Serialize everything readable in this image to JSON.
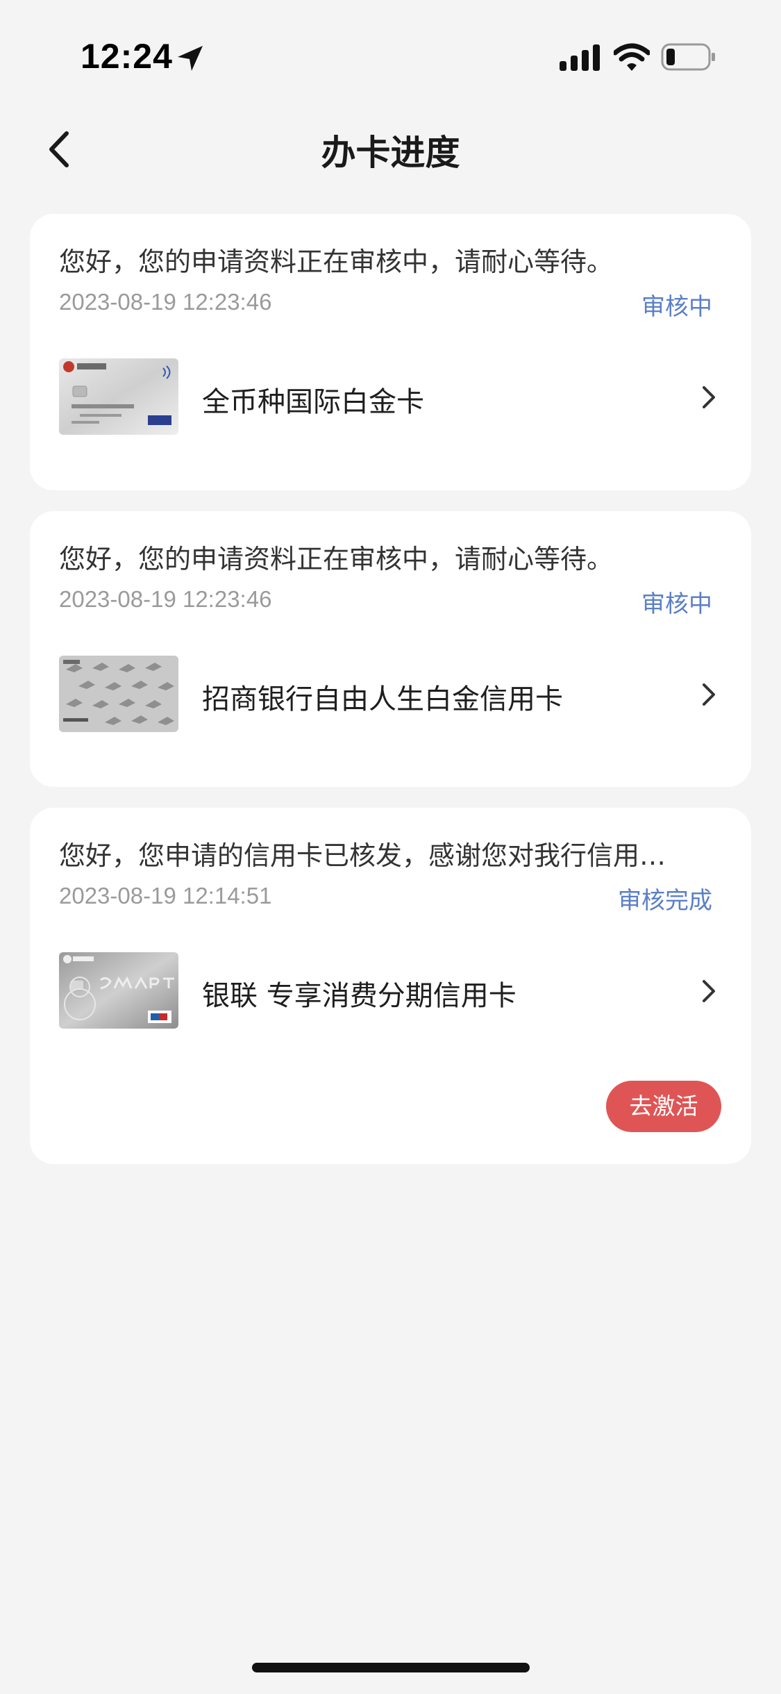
{
  "status_bar": {
    "time": "12:24",
    "icons": [
      "location-arrow-icon",
      "cellular-signal-icon",
      "wifi-icon",
      "battery-icon"
    ]
  },
  "nav": {
    "title": "办卡进度",
    "back_icon": "chevron-left-icon"
  },
  "colors": {
    "background": "#f4f4f5",
    "card": "#ffffff",
    "status_text": "#5b7fc7",
    "time_text": "#9a9a9a",
    "activate_button": "#df5555"
  },
  "applications": [
    {
      "message": "您好，您的申请资料正在审核中，请耐心等待。",
      "time": "2023-08-19 12:23:46",
      "status": "审核中",
      "card_name": "全币种国际白金卡"
    },
    {
      "message": "您好，您的申请资料正在审核中，请耐心等待。",
      "time": "2023-08-19 12:23:46",
      "status": "审核中",
      "card_name": "招商银行自由人生白金信用卡"
    },
    {
      "message": "您好，您申请的信用卡已核发，感谢您对我行信用…",
      "time": "2023-08-19 12:14:51",
      "status": "审核完成",
      "card_name": "银联 专享消费分期信用卡",
      "action_label": "去激活"
    }
  ]
}
